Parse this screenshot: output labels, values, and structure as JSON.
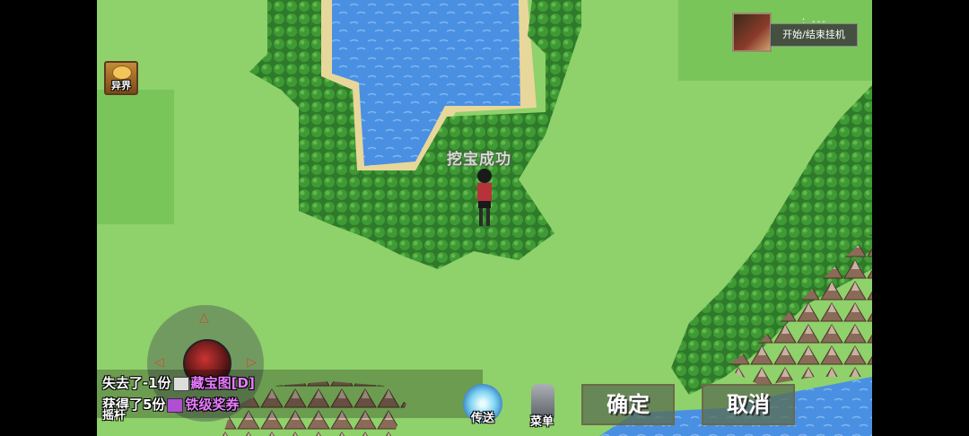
{
  "hud": {
    "otherworld_label": "异界",
    "floating_text": "挖宝成功",
    "auto_battle": {
      "dots": "：---",
      "button_label": "开始/结束挂机"
    },
    "joystick_label": "摇杆",
    "messages": {
      "line1_prefix": "失去了-1份",
      "line1_item": "藏宝图[D]",
      "line2_prefix": "获得了5份",
      "line2_item": "铁级奖券"
    },
    "teleport_label": "传送",
    "menu_label": "菜单",
    "confirm_label": "确定",
    "cancel_label": "取消"
  },
  "icons": [
    "treasure-chest-icon",
    "boss-portrait-icon",
    "teleport-orb-icon",
    "knight-menu-icon",
    "map-item-icon",
    "ticket-item-icon"
  ],
  "colors": {
    "grass": "#8fd16a",
    "water": "#4a90e2",
    "forest": "#2f7a2a",
    "sand": "#e8d79a",
    "item_purple": "#e87bff"
  }
}
